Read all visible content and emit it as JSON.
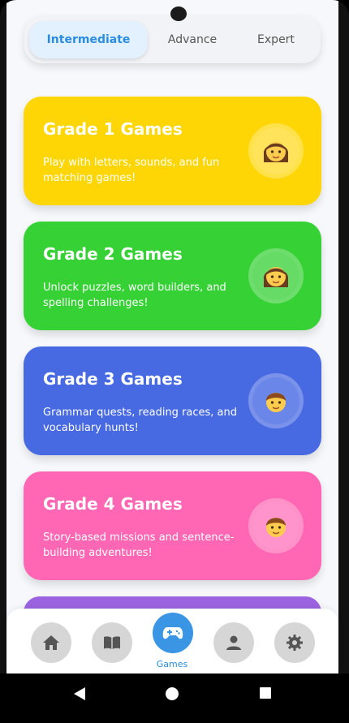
{
  "tabs": [
    {
      "label": "Intermediate",
      "active": true
    },
    {
      "label": "Advance",
      "active": false
    },
    {
      "label": "Expert",
      "active": false
    }
  ],
  "cards": [
    {
      "title": "Grade 1 Games",
      "desc": "Play with letters, sounds, and fun matching games!",
      "color": "#ffd605",
      "avatar_icon": "girl-face-icon"
    },
    {
      "title": "Grade 2 Games",
      "desc": "Unlock puzzles, word builders, and spelling challenges!",
      "color": "#35d135",
      "avatar_icon": "girl-face-icon"
    },
    {
      "title": "Grade 3 Games",
      "desc": "Grammar quests, reading races, and vocabulary hunts!",
      "color": "#4769e1",
      "avatar_icon": "boy-face-icon"
    },
    {
      "title": "Grade 4 Games",
      "desc": "Story-based missions and sentence-building adventures!",
      "color": "#ff67b4",
      "avatar_icon": "boy-face-icon"
    }
  ],
  "next_card_color": "#9b63e0",
  "bottom_nav": {
    "items": [
      {
        "icon": "home-icon",
        "active": false
      },
      {
        "icon": "book-icon",
        "active": false
      },
      {
        "icon": "gamepad-icon",
        "active": true,
        "label": "Games"
      },
      {
        "icon": "profile-icon",
        "active": false
      },
      {
        "icon": "settings-icon",
        "active": false
      }
    ],
    "active_color": "#3a95e4"
  },
  "system_nav": [
    "back-icon",
    "home-circle-icon",
    "recents-icon"
  ]
}
